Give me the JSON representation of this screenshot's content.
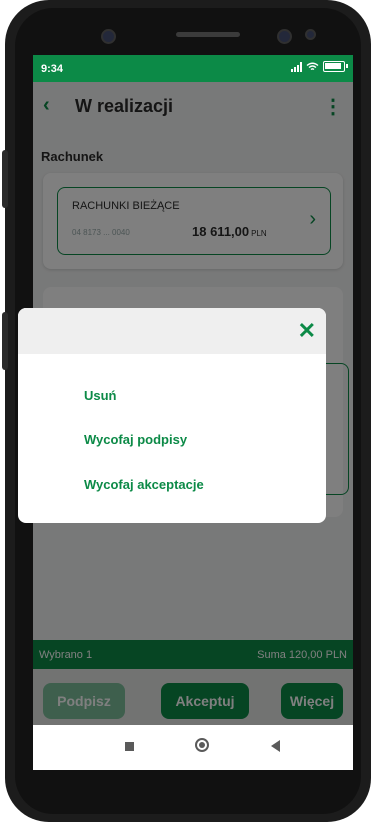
{
  "status": {
    "time": "9:34"
  },
  "header": {
    "back_icon": "chevron-left-icon",
    "title": "W realizacji",
    "menu_icon": "kebab-icon"
  },
  "account": {
    "section_label": "Rachunek",
    "name": "RACHUNKI BIEŻĄCE",
    "number": "04 8173 ... 0040",
    "balance": "18 611,00",
    "currency": "PLN"
  },
  "footer": {
    "selected": "Wybrano 1",
    "sum": "Suma   120,00 PLN"
  },
  "actions": {
    "sign": "Podpisz",
    "accept": "Akceptuj",
    "more": "Więcej"
  },
  "dialog": {
    "close_icon": "close-icon",
    "options": [
      "Usuń",
      "Wycofaj podpisy",
      "Wycofaj akceptacje"
    ]
  },
  "colors": {
    "brand": "#0c8a47",
    "brand_disabled": "#7dbf9b"
  }
}
